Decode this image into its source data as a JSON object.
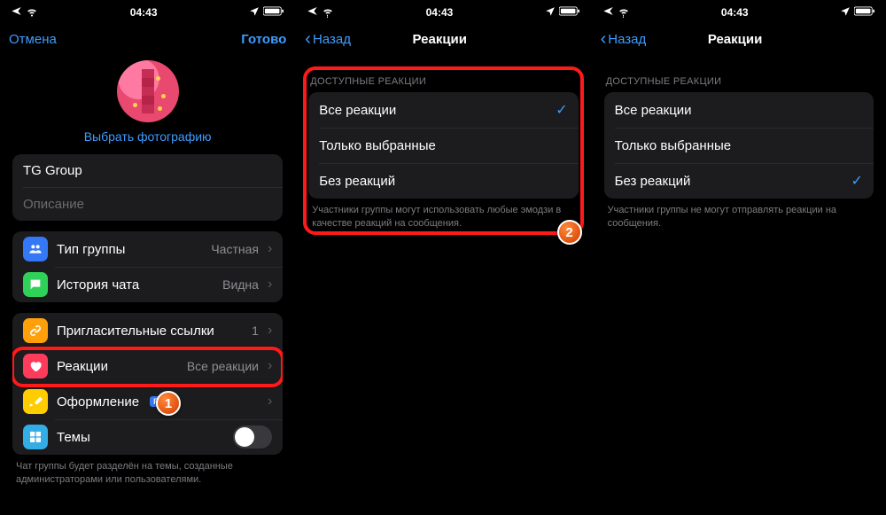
{
  "status": {
    "time": "04:43"
  },
  "s1": {
    "nav": {
      "cancel": "Отмена",
      "done": "Готово"
    },
    "choose_photo": "Выбрать фотографию",
    "group_name": "TG Group",
    "desc_placeholder": "Описание",
    "rows": {
      "type": {
        "label": "Тип группы",
        "value": "Частная"
      },
      "history": {
        "label": "История чата",
        "value": "Видна"
      },
      "invite": {
        "label": "Пригласительные ссылки",
        "value": "1"
      },
      "reactions": {
        "label": "Реакции",
        "value": "Все реакции"
      },
      "appearance": {
        "label": "Оформление",
        "badge": "FREE"
      },
      "themes": {
        "label": "Темы"
      }
    },
    "footer": "Чат группы будет разделён на темы, созданные администраторами или пользователями."
  },
  "s2": {
    "nav": {
      "back": "Назад",
      "title": "Реакции"
    },
    "section": "ДОСТУПНЫЕ РЕАКЦИИ",
    "options": {
      "all": "Все реакции",
      "selected": "Только выбранные",
      "none": "Без реакций"
    },
    "selected_key": "all",
    "footer": "Участники группы могут использовать любые эмодзи в качестве реакций на сообщения."
  },
  "s3": {
    "nav": {
      "back": "Назад",
      "title": "Реакции"
    },
    "section": "ДОСТУПНЫЕ РЕАКЦИИ",
    "options": {
      "all": "Все реакции",
      "selected": "Только выбранные",
      "none": "Без реакций"
    },
    "selected_key": "none",
    "footer": "Участники группы не могут отправлять реакции на сообщения."
  },
  "badges": {
    "one": "1",
    "two": "2"
  }
}
